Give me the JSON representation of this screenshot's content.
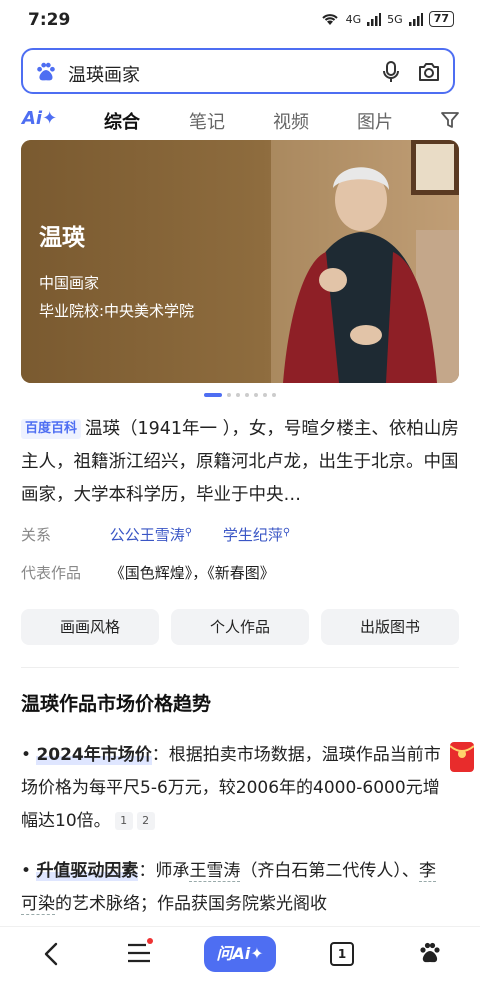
{
  "status": {
    "time": "7:29",
    "signal1": "4G",
    "signal2": "5G",
    "battery": "77"
  },
  "search": {
    "query": "温瑛画家"
  },
  "tabs": {
    "ai": "Ai✦",
    "items": [
      "综合",
      "笔记",
      "视频",
      "图片"
    ]
  },
  "hero": {
    "name": "温瑛",
    "line1": "中国画家",
    "line2": "毕业院校:中央美术学院"
  },
  "summary": {
    "badge": "百度百科",
    "text": "温瑛（1941年一 ），女，号暄夕楼主、依柏山房主人，祖籍浙江绍兴，原籍河北卢龙，出生于北京。中国画家，大学本科学历，毕业于中央…"
  },
  "relations": {
    "label": "关系",
    "items": [
      "公公王雪涛",
      "学生纪萍"
    ]
  },
  "works": {
    "label": "代表作品",
    "value": "《国色辉煌》，《新春图》"
  },
  "buttons": [
    "画画风格",
    "个人作品",
    "出版图书"
  ],
  "section": {
    "title": "温瑛作品市场价格趋势"
  },
  "bullets": {
    "b1_title": "2024年市场价",
    "b1_text": "：根据拍卖市场数据，温瑛作品当前市场价格为每平尺5-6万元，较2006年的4000-6000元增幅达10倍。",
    "b1_ref1": "1",
    "b1_ref2": "2",
    "b2_title": "升值驱动因素",
    "b2_pre": "：师承",
    "b2_link1": "王雪涛",
    "b2_mid": "（齐白石第二代传人）、",
    "b2_link2": "李可染",
    "b2_post": "的艺术脉络；作品获国务院紫光阁收"
  },
  "nav": {
    "ask": "问Ai✦",
    "tabs_count": "1"
  },
  "colors": {
    "accent": "#4e6ef2",
    "link": "#3a56c5",
    "hero_bg": "#8a6a3e"
  }
}
